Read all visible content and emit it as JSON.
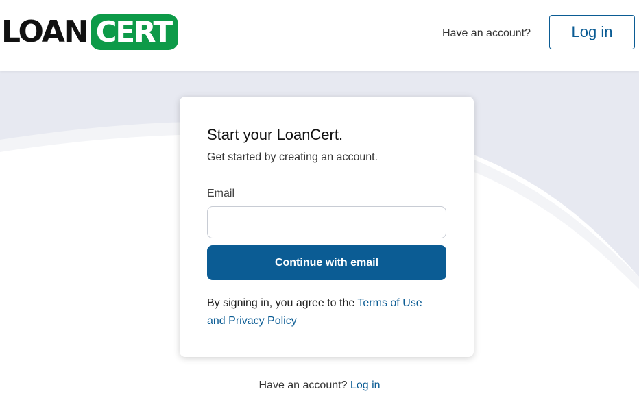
{
  "brand": {
    "logo_left": "LOAN",
    "logo_right": "CERT",
    "logo_green": "#0d9a48"
  },
  "header": {
    "have_account_text": "Have an account?",
    "login_button": "Log in"
  },
  "card": {
    "title": "Start your LoanCert.",
    "subtitle": "Get started by creating an account.",
    "email_label": "Email",
    "email_value": "",
    "email_placeholder": "",
    "continue_button": "Continue with email",
    "terms_prefix": "By signing in, you agree to the ",
    "terms_link": "Terms of Use",
    "terms_and": "and",
    "privacy_link": "Privacy Policy"
  },
  "footer": {
    "have_account_text": "Have an account?",
    "login_link": "Log in"
  },
  "colors": {
    "accent": "#0b5c94",
    "background_band": "#e7e9f1"
  }
}
